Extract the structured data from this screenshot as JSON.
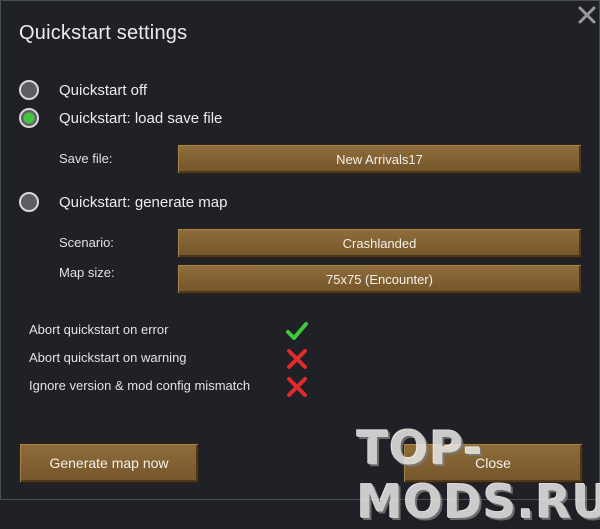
{
  "dialog": {
    "title": "Quickstart settings",
    "close_icon": "close-icon"
  },
  "radios": [
    {
      "label": "Quickstart off",
      "selected": false
    },
    {
      "label": "Quickstart: load save file",
      "selected": true
    },
    {
      "label": "Quickstart: generate map",
      "selected": false
    }
  ],
  "fields": {
    "save_file": {
      "label": "Save file:",
      "value": "New Arrivals17"
    },
    "scenario": {
      "label": "Scenario:",
      "value": "Crashlanded"
    },
    "map_size": {
      "label": "Map size:",
      "value": "75x75 (Encounter)"
    }
  },
  "options": [
    {
      "label": "Abort quickstart on error",
      "checked": true
    },
    {
      "label": "Abort quickstart on warning",
      "checked": false
    },
    {
      "label": "Ignore version & mod config mismatch",
      "checked": false
    }
  ],
  "buttons": {
    "generate": "Generate map now",
    "close": "Close"
  },
  "watermark": "TOP-MODS.RU",
  "colors": {
    "background": "#1f2126",
    "button_wood": "#8f6d3b",
    "radio_selected": "#3ec83a",
    "check_green": "#3ec83a",
    "cross_red": "#e02b2b"
  }
}
